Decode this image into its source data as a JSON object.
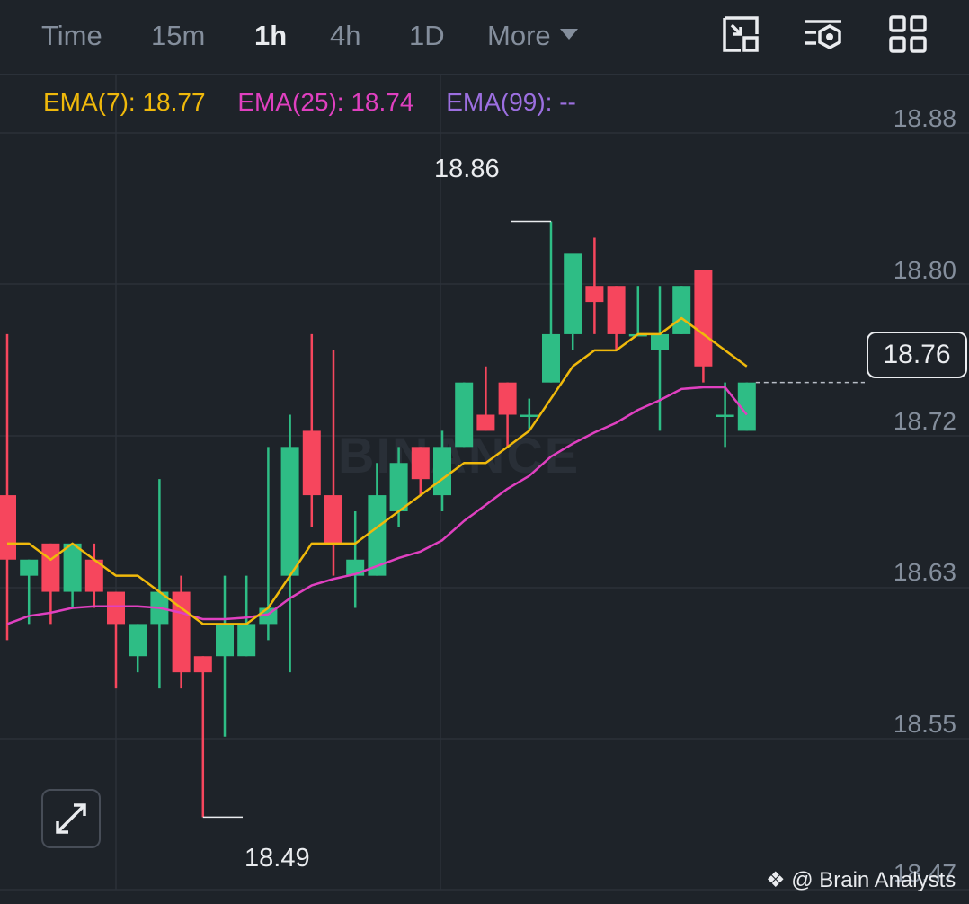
{
  "toolbar": {
    "timeframes": [
      {
        "label": "Time",
        "active": false
      },
      {
        "label": "15m",
        "active": false
      },
      {
        "label": "1h",
        "active": true
      },
      {
        "label": "4h",
        "active": false
      },
      {
        "label": "1D",
        "active": false
      }
    ],
    "more_label": "More",
    "icons": [
      "picture-in-picture-icon",
      "indicator-settings-icon",
      "layout-grid-icon"
    ]
  },
  "indicators": {
    "ema7": {
      "label": "EMA(7): 18.77",
      "color": "#f0b90b"
    },
    "ema25": {
      "label": "EMA(25): 18.74",
      "color": "#e040c0"
    },
    "ema99": {
      "label": "EMA(99): --",
      "color": "#9c6fe0"
    }
  },
  "price_axis": [
    "18.88",
    "18.80",
    "18.72",
    "18.63",
    "18.55",
    "18.47"
  ],
  "current_price": "18.76",
  "annotations": {
    "high": "18.86",
    "low": "18.49"
  },
  "watermark": "BINANCE",
  "credit": "@ Brain Analysts",
  "colors": {
    "up": "#2ebd85",
    "down": "#f6465d",
    "bg": "#1e2329",
    "grid": "#2b3139"
  },
  "chart_data": {
    "type": "candlestick",
    "ylim": [
      18.445,
      18.915
    ],
    "candles": [
      {
        "o": 18.69,
        "h": 18.79,
        "l": 18.6,
        "c": 18.65
      },
      {
        "o": 18.64,
        "h": 18.65,
        "l": 18.61,
        "c": 18.65
      },
      {
        "o": 18.66,
        "h": 18.66,
        "l": 18.61,
        "c": 18.63
      },
      {
        "o": 18.63,
        "h": 18.66,
        "l": 18.62,
        "c": 18.66
      },
      {
        "o": 18.65,
        "h": 18.66,
        "l": 18.62,
        "c": 18.63
      },
      {
        "o": 18.63,
        "h": 18.63,
        "l": 18.57,
        "c": 18.61
      },
      {
        "o": 18.59,
        "h": 18.61,
        "l": 18.58,
        "c": 18.61
      },
      {
        "o": 18.61,
        "h": 18.7,
        "l": 18.57,
        "c": 18.63
      },
      {
        "o": 18.63,
        "h": 18.64,
        "l": 18.57,
        "c": 18.58
      },
      {
        "o": 18.59,
        "h": 18.59,
        "l": 18.49,
        "c": 18.58
      },
      {
        "o": 18.59,
        "h": 18.64,
        "l": 18.54,
        "c": 18.61
      },
      {
        "o": 18.59,
        "h": 18.64,
        "l": 18.59,
        "c": 18.61
      },
      {
        "o": 18.61,
        "h": 18.72,
        "l": 18.6,
        "c": 18.62
      },
      {
        "o": 18.64,
        "h": 18.74,
        "l": 18.58,
        "c": 18.72
      },
      {
        "o": 18.73,
        "h": 18.79,
        "l": 18.67,
        "c": 18.69
      },
      {
        "o": 18.69,
        "h": 18.78,
        "l": 18.64,
        "c": 18.66
      },
      {
        "o": 18.64,
        "h": 18.68,
        "l": 18.62,
        "c": 18.65
      },
      {
        "o": 18.64,
        "h": 18.71,
        "l": 18.64,
        "c": 18.69
      },
      {
        "o": 18.68,
        "h": 18.72,
        "l": 18.67,
        "c": 18.71
      },
      {
        "o": 18.72,
        "h": 18.72,
        "l": 18.69,
        "c": 18.7
      },
      {
        "o": 18.69,
        "h": 18.73,
        "l": 18.68,
        "c": 18.72
      },
      {
        "o": 18.72,
        "h": 18.76,
        "l": 18.72,
        "c": 18.76
      },
      {
        "o": 18.74,
        "h": 18.77,
        "l": 18.73,
        "c": 18.73
      },
      {
        "o": 18.76,
        "h": 18.76,
        "l": 18.72,
        "c": 18.74
      },
      {
        "o": 18.74,
        "h": 18.75,
        "l": 18.73,
        "c": 18.74
      },
      {
        "o": 18.76,
        "h": 18.86,
        "l": 18.76,
        "c": 18.79
      },
      {
        "o": 18.79,
        "h": 18.79,
        "l": 18.78,
        "c": 18.84
      },
      {
        "o": 18.82,
        "h": 18.85,
        "l": 18.79,
        "c": 18.81
      },
      {
        "o": 18.82,
        "h": 18.82,
        "l": 18.78,
        "c": 18.79
      },
      {
        "o": 18.79,
        "h": 18.82,
        "l": 18.79,
        "c": 18.79
      },
      {
        "o": 18.78,
        "h": 18.82,
        "l": 18.73,
        "c": 18.79
      },
      {
        "o": 18.79,
        "h": 18.82,
        "l": 18.79,
        "c": 18.82
      },
      {
        "o": 18.83,
        "h": 18.83,
        "l": 18.76,
        "c": 18.77
      },
      {
        "o": 18.74,
        "h": 18.76,
        "l": 18.72,
        "c": 18.74
      },
      {
        "o": 18.73,
        "h": 18.76,
        "l": 18.73,
        "c": 18.76
      }
    ],
    "ema7": [
      18.66,
      18.66,
      18.65,
      18.66,
      18.65,
      18.64,
      18.64,
      18.63,
      18.62,
      18.61,
      18.61,
      18.61,
      18.62,
      18.64,
      18.66,
      18.66,
      18.66,
      18.67,
      18.68,
      18.69,
      18.7,
      18.71,
      18.71,
      18.72,
      18.73,
      18.75,
      18.77,
      18.78,
      18.78,
      18.79,
      18.79,
      18.8,
      18.79,
      18.78,
      18.77
    ],
    "ema25": [
      18.61,
      18.615,
      18.617,
      18.62,
      18.621,
      18.621,
      18.621,
      18.62,
      18.617,
      18.613,
      18.613,
      18.614,
      18.616,
      18.626,
      18.634,
      18.638,
      18.641,
      18.646,
      18.651,
      18.655,
      18.662,
      18.674,
      18.684,
      18.694,
      18.702,
      18.714,
      18.722,
      18.729,
      18.735,
      18.743,
      18.749,
      18.756,
      18.757,
      18.757,
      18.74
    ]
  }
}
